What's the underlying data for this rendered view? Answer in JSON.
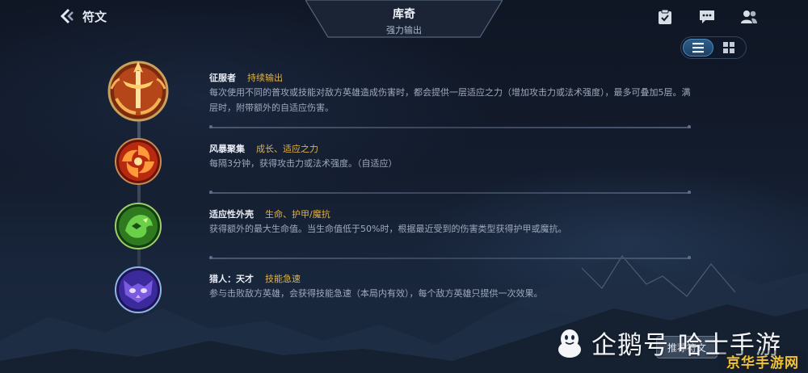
{
  "header": {
    "back_label": "符文",
    "hero_name": "库奇",
    "hero_role": "强力输出"
  },
  "top_icons": [
    "clipboard-check-icon",
    "chat-icon",
    "friends-icon"
  ],
  "view_toggle": {
    "active": "list",
    "options": [
      "list-view-icon",
      "grid-view-icon"
    ]
  },
  "runes": [
    {
      "name": "征服者",
      "tag": "持续输出",
      "desc": "每次使用不同的普攻或技能对敌方英雄造成伤害时，都会提供一层适应之力（增加攻击力或法术强度），最多可叠加5层。满层时，附带额外的自适应伤害。",
      "icon": "conqueror-icon",
      "color": "#d8772a"
    },
    {
      "name": "风暴聚集",
      "tag": "成长、适应之力",
      "desc": "每隔3分钟，获得攻击力或法术强度。（自适应）",
      "icon": "gathering-storm-icon",
      "color": "#d8432a"
    },
    {
      "name": "适应性外壳",
      "tag": "生命、护甲/魔抗",
      "desc": "获得额外的最大生命值。当生命值低于50%时，根据最近受到的伤害类型获得护甲或魔抗。",
      "icon": "adaptive-shell-icon",
      "color": "#4ab03a"
    },
    {
      "name": "猎人：天才",
      "tag": "技能急速",
      "desc": "参与击败敌方英雄，会获得技能急速（本局内有效），每个敌方英雄只提供一次效果。",
      "icon": "ultimate-hunter-icon",
      "color": "#7a5ae0"
    }
  ],
  "recommend_button": "推荐符文",
  "watermark": {
    "text": "企鹅号 哈士手游",
    "corner": "京华手游网"
  }
}
